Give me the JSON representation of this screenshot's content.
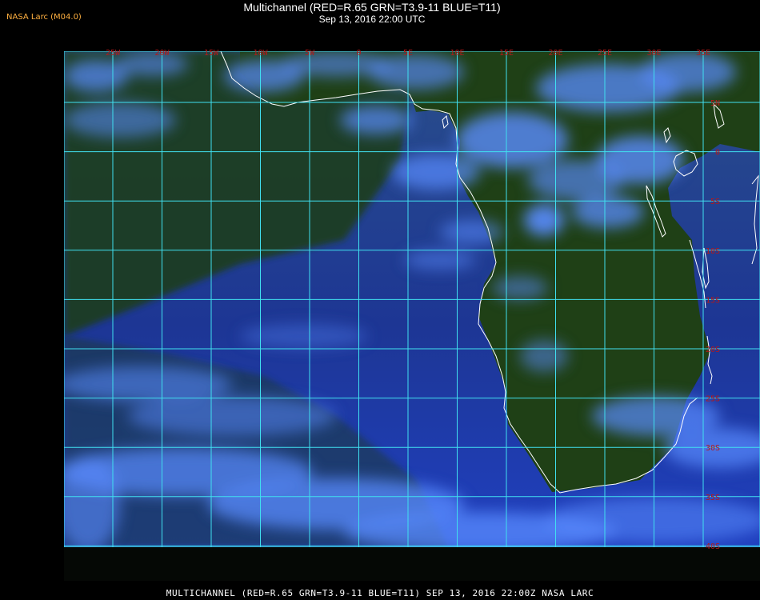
{
  "header": {
    "credit": "NASA Larc (M04.0)",
    "title": "Multichannel (RED=R.65 GRN=T3.9-11 BLUE=T11)",
    "subtitle": "Sep 13, 2016 22:00 UTC"
  },
  "footer": {
    "caption": "MULTICHANNEL (RED=R.65 GRN=T3.9-11 BLUE=T11) SEP 13, 2016 22:00Z   NASA LARC"
  },
  "map": {
    "longitude_labels": [
      "25W",
      "20W",
      "15W",
      "10W",
      "5W",
      "0",
      "5E",
      "10E",
      "15E",
      "20E",
      "25E",
      "30E",
      "35E"
    ],
    "latitude_labels": [
      "5N",
      "0",
      "5S",
      "10S",
      "15S",
      "20S",
      "25S",
      "30S",
      "35S",
      "40S"
    ],
    "colors": {
      "grid": "#40e0f0",
      "coastline": "#ffffff",
      "label": "#b81818",
      "land": "#1c3d14",
      "ocean": "#1a2f7a",
      "cloud": "#5a8cff"
    }
  }
}
